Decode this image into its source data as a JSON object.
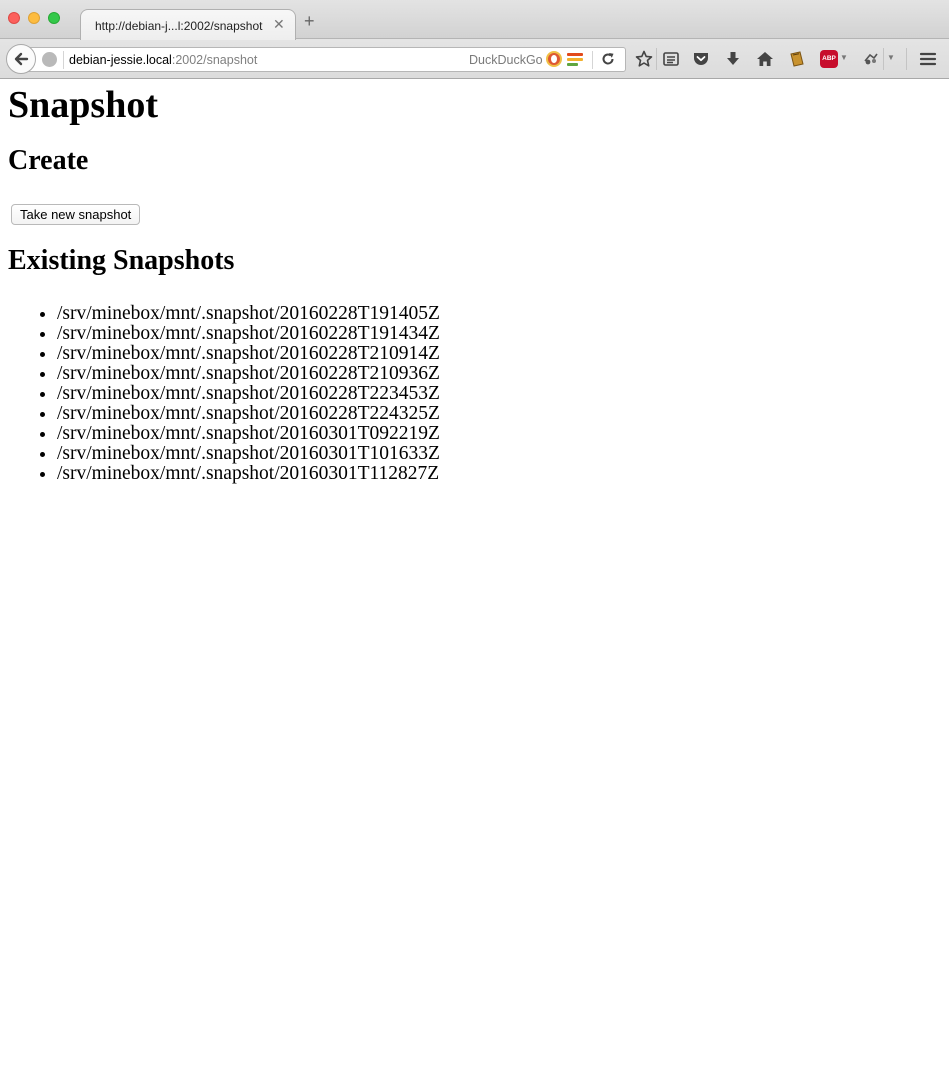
{
  "browser": {
    "tab_title": "http://debian-j...l:2002/snapshot",
    "tab_close_glyph": "✕",
    "new_tab_glyph": "+",
    "url_host": "debian-jessie.local",
    "url_path": ":2002/snapshot",
    "search_engine": "DuckDuckGo",
    "toolbar_icons": [
      "bookmark-star-icon",
      "reading-list-icon",
      "pocket-icon",
      "download-icon",
      "home-icon",
      "bookmarklet-icon",
      "adblock-plus-icon",
      "extension-icon",
      "menu-icon"
    ],
    "abp_label": "ABP",
    "colors": {
      "close": "#fc605c",
      "minimize": "#fdbc40",
      "maximize": "#34c84a",
      "abp": "#c70d2c",
      "ddg": "#de5833"
    }
  },
  "page": {
    "title": "Snapshot",
    "create_heading": "Create",
    "take_snapshot_label": "Take new snapshot",
    "existing_heading": "Existing Snapshots",
    "snapshots": [
      "/srv/minebox/mnt/.snapshot/20160228T191405Z",
      "/srv/minebox/mnt/.snapshot/20160228T191434Z",
      "/srv/minebox/mnt/.snapshot/20160228T210914Z",
      "/srv/minebox/mnt/.snapshot/20160228T210936Z",
      "/srv/minebox/mnt/.snapshot/20160228T223453Z",
      "/srv/minebox/mnt/.snapshot/20160228T224325Z",
      "/srv/minebox/mnt/.snapshot/20160301T092219Z",
      "/srv/minebox/mnt/.snapshot/20160301T101633Z",
      "/srv/minebox/mnt/.snapshot/20160301T112827Z"
    ]
  }
}
